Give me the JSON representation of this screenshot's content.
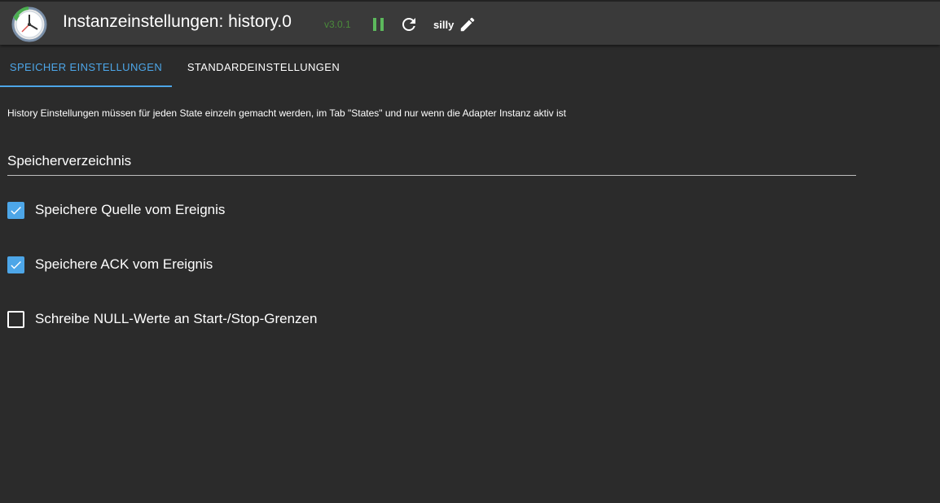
{
  "header": {
    "title": "Instanzeinstellungen: history.0",
    "version": "v3.0.1",
    "log_level": "silly",
    "logo_icon": "history-clock-icon",
    "pause_icon": "pause-icon",
    "reload_icon": "reload-icon",
    "edit_icon": "pencil-icon",
    "colors": {
      "header_bg": "#3a3a3a",
      "version": "#4a8a3a",
      "pause": "#5cb85c"
    }
  },
  "tabs": [
    {
      "label": "SPEICHER EINSTELLUNGEN",
      "active": true
    },
    {
      "label": "STANDARDEINSTELLUNGEN",
      "active": false
    }
  ],
  "main": {
    "info_text": "History Einstellungen müssen für jeden State einzeln gemacht werden, im Tab \"States\" und nur wenn die Adapter Instanz aktiv ist",
    "section_title": "Speicherverzeichnis",
    "checkboxes": [
      {
        "label": "Speichere Quelle vom Ereignis",
        "checked": true
      },
      {
        "label": "Speichere ACK vom Ereignis",
        "checked": true
      },
      {
        "label": "Schreibe NULL-Werte an Start-/Stop-Grenzen",
        "checked": false
      }
    ]
  },
  "colors": {
    "background": "#2b2b2b",
    "accent": "#4da6e8"
  }
}
